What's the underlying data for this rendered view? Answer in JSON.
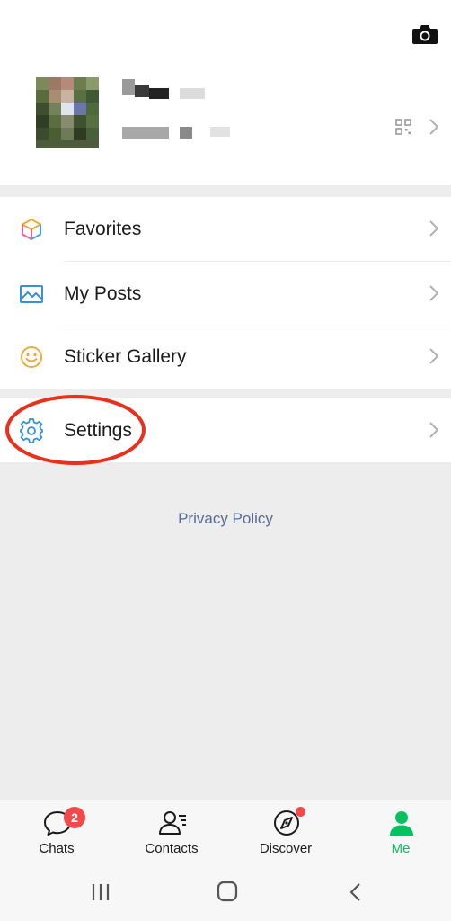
{
  "profile": {
    "camera_icon": "camera-icon",
    "qr_icon": "qr-code-icon"
  },
  "menu": {
    "items": [
      {
        "label": "Favorites",
        "icon": "cube-icon"
      },
      {
        "label": "My Posts",
        "icon": "image-icon"
      },
      {
        "label": "Sticker Gallery",
        "icon": "smiley-icon"
      },
      {
        "label": "Settings",
        "icon": "gear-icon"
      }
    ]
  },
  "privacy_policy": "Privacy Policy",
  "bottom_nav": {
    "items": [
      {
        "label": "Chats",
        "badge": "2",
        "icon": "chat-bubble-icon"
      },
      {
        "label": "Contacts",
        "icon": "contacts-icon"
      },
      {
        "label": "Discover",
        "icon": "compass-icon"
      },
      {
        "label": "Me",
        "icon": "person-icon",
        "active": true
      }
    ]
  },
  "colors": {
    "accent_green": "#07c160",
    "highlight_red": "#e8301c",
    "link_blue": "#576b95",
    "badge_red": "#f04a4a"
  }
}
